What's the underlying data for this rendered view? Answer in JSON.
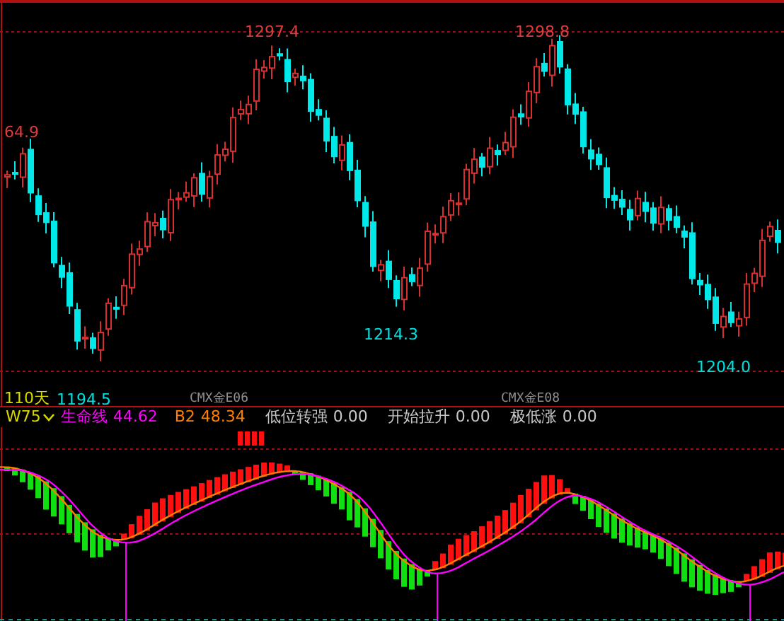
{
  "main_chart": {
    "price_labels": [
      {
        "text": "1297.4",
        "color": "#e03c3c"
      },
      {
        "text": "1298.8",
        "color": "#e03c3c"
      },
      {
        "text": "64.9",
        "color": "#e03c3c"
      },
      {
        "text": "1214.3",
        "color": "#00e0e0"
      },
      {
        "text": "1194.5",
        "color": "#00e0e0"
      },
      {
        "text": "1204.0",
        "color": "#00e0e0"
      }
    ],
    "period": "110天",
    "contract_marks": [
      "CMX金E06",
      "CMX金E08"
    ]
  },
  "indicator": {
    "name": "W75",
    "lines": [
      {
        "label": "生命线",
        "value": "44.62",
        "color": "#ff00ff"
      },
      {
        "label": "B2",
        "value": "48.34",
        "color": "#ff8000"
      },
      {
        "label": "低位转强",
        "value": "0.00",
        "color": "#c8c8c8"
      },
      {
        "label": "开始拉升",
        "value": "0.00",
        "color": "#c8c8c8"
      },
      {
        "label": "极低涨",
        "value": "0.00",
        "color": "#c8c8c8"
      }
    ]
  }
}
